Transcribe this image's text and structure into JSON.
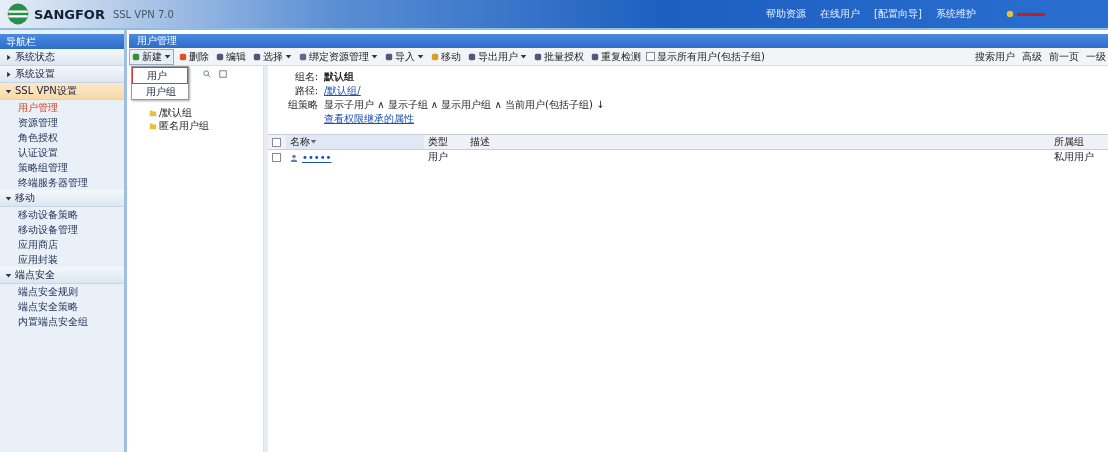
{
  "header": {
    "logo": "SANGFOR",
    "product": "SSL VPN 7.0",
    "links": [
      "帮助资源",
      "在线用户",
      "[配置向导]",
      "系统维护"
    ]
  },
  "sidebar": {
    "title": "导航栏",
    "sections": [
      {
        "label": "系统状态",
        "expanded": false,
        "selected": false
      },
      {
        "label": "系统设置",
        "expanded": false,
        "selected": false
      },
      {
        "label": "SSL VPN设置",
        "expanded": true,
        "selected": true,
        "items": [
          {
            "label": "用户管理",
            "selected": true
          },
          {
            "label": "资源管理",
            "selected": false
          },
          {
            "label": "角色授权",
            "selected": false
          },
          {
            "label": "认证设置",
            "selected": false
          },
          {
            "label": "策略组管理",
            "selected": false
          },
          {
            "label": "终端服务器管理",
            "selected": false
          }
        ]
      },
      {
        "label": "移动",
        "expanded": true,
        "selected": false,
        "items": [
          {
            "label": "移动设备策略",
            "selected": false
          },
          {
            "label": "移动设备管理",
            "selected": false
          },
          {
            "label": "应用商店",
            "selected": false
          },
          {
            "label": "应用封装",
            "selected": false
          }
        ]
      },
      {
        "label": "端点安全",
        "expanded": true,
        "selected": false,
        "items": [
          {
            "label": "端点安全规则",
            "selected": false
          },
          {
            "label": "端点安全策略",
            "selected": false
          },
          {
            "label": "内置端点安全组",
            "selected": false
          }
        ]
      }
    ]
  },
  "panel": {
    "title": "用户管理",
    "toolbar": [
      {
        "kind": "dropdown",
        "label": "新建"
      },
      {
        "kind": "button",
        "label": "删除"
      },
      {
        "kind": "button",
        "label": "编辑"
      },
      {
        "kind": "dropdown",
        "label": "选择"
      },
      {
        "kind": "dropdown",
        "label": "绑定资源管理"
      },
      {
        "kind": "dropdown",
        "label": "导入"
      },
      {
        "kind": "button",
        "label": "移动"
      },
      {
        "kind": "dropdown",
        "label": "导出用户"
      },
      {
        "kind": "button",
        "label": "批量授权"
      },
      {
        "kind": "button",
        "label": "重复检测"
      },
      {
        "kind": "checkbox",
        "label": "显示所有用户(包括子组)",
        "checked": false
      }
    ],
    "toolbar_right": [
      "搜索用户",
      "高级",
      "前一页",
      "一级"
    ],
    "menu": [
      {
        "label": "用户",
        "selected": true
      },
      {
        "label": "用户组",
        "selected": false
      }
    ],
    "tree": [
      {
        "label": "/默认组",
        "selected": false
      },
      {
        "label": "匿名用户组",
        "selected": false
      }
    ],
    "info": {
      "name_label": "组名:",
      "name": "默认组",
      "path_label": "路径:",
      "path": "/默认组/",
      "filter_label": "组策略",
      "filter": "显示子用户 ∧ 显示子组 ∧ 显示用户组 ∧ 当前用户(包括子组) ↓",
      "link": "查看权限继承的属性"
    },
    "table": {
      "all_checked": false,
      "columns": [
        "名称",
        "类型",
        "描述",
        "所属组"
      ],
      "rows": [
        {
          "checked": false,
          "cells": [
            "•••••",
            "用户",
            "",
            "私用用户"
          ]
        }
      ]
    }
  }
}
